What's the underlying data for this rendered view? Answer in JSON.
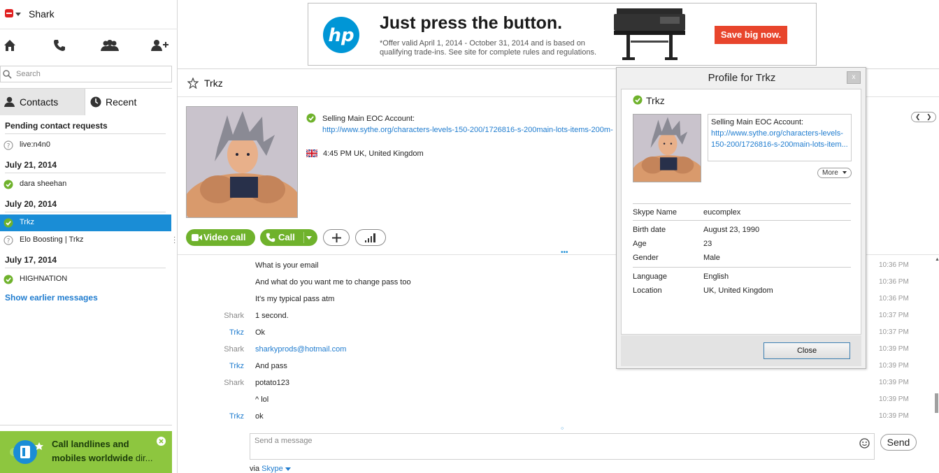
{
  "app": {
    "user_name": "Shark"
  },
  "nav": {
    "icons": [
      "home-icon",
      "phone-icon",
      "contacts-group-icon",
      "add-contact-icon"
    ]
  },
  "search": {
    "placeholder": "Search"
  },
  "tabs": {
    "contacts": "Contacts",
    "recent": "Recent"
  },
  "recent": {
    "pending_header": "Pending contact requests",
    "pending_items": [
      {
        "name": "live:n4n0",
        "status": "pending"
      }
    ],
    "groups": [
      {
        "date": "July 21, 2014",
        "items": [
          {
            "name": "dara sheehan",
            "status": "online"
          }
        ]
      },
      {
        "date": "July 20, 2014",
        "items": [
          {
            "name": "Trkz",
            "status": "online",
            "selected": true
          },
          {
            "name": "Elo Boosting | Trkz",
            "status": "pending"
          }
        ]
      },
      {
        "date": "July 17, 2014",
        "items": [
          {
            "name": "HIGHNATION",
            "status": "online"
          }
        ]
      }
    ],
    "show_earlier": "Show earlier messages"
  },
  "promo": {
    "line1": "Call landlines and",
    "line2_bold": "mobiles worldwide",
    "line2_rest": " dir..."
  },
  "ad": {
    "headline": "Just press the button.",
    "fine_print": "*Offer valid April 1, 2014 - October 31, 2014 and is based on qualifying trade-ins. See site for complete rules and regulations.",
    "cta": "Save big now.",
    "brand_color": "#0096d6",
    "cta_color": "#e8452c"
  },
  "conversation": {
    "title": "Trkz",
    "mood_text": "Selling Main EOC Account:",
    "mood_link": "http://www.sythe.org/characters-levels-150-200/1726816-s-200main-lots-items-200m-",
    "local_time": "4:45 PM UK, United Kingdom",
    "buttons": {
      "video": "Video call",
      "call": "Call"
    },
    "accent_color": "#6fb22c",
    "messages": [
      {
        "sender": "",
        "text": "What is your email",
        "time": "10:36 PM"
      },
      {
        "sender": "",
        "text": "And what do you want me to change pass too",
        "time": "10:36 PM"
      },
      {
        "sender": "",
        "text": "It's my typical pass atm",
        "time": "10:36 PM"
      },
      {
        "sender": "Shark",
        "text": "1 second.",
        "time": "10:37 PM"
      },
      {
        "sender": "Trkz",
        "text": "Ok",
        "time": "10:37 PM"
      },
      {
        "sender": "Shark",
        "text": "sharkyprods@hotmail.com",
        "time": "10:39 PM",
        "link": true
      },
      {
        "sender": "Trkz",
        "text": "And pass",
        "time": "10:39 PM"
      },
      {
        "sender": "Shark",
        "text": "potato123",
        "time": "10:39 PM"
      },
      {
        "sender": "",
        "text": "^ lol",
        "time": "10:39 PM"
      },
      {
        "sender": "Trkz",
        "text": "ok",
        "time": "10:39 PM"
      }
    ],
    "compose_placeholder": "Send a message",
    "send": "Send",
    "via_prefix": "via ",
    "via_link": "Skype"
  },
  "profile": {
    "title": "Profile for Trkz",
    "close_x": "x",
    "name": "Trkz",
    "mood_text": "Selling Main EOC Account:",
    "mood_link": "http://www.sythe.org/characters-levels-150-200/1726816-s-200main-lots-item...",
    "more": "More",
    "fields": [
      {
        "label": "Skype Name",
        "value": "eucomplex"
      },
      {
        "label": "Birth date",
        "value": "August 23, 1990"
      },
      {
        "label": "Age",
        "value": "23"
      },
      {
        "label": "Gender",
        "value": "Male"
      },
      {
        "label": "Language",
        "value": "English"
      },
      {
        "label": "Location",
        "value": "UK, United Kingdom"
      }
    ],
    "close_button": "Close"
  }
}
